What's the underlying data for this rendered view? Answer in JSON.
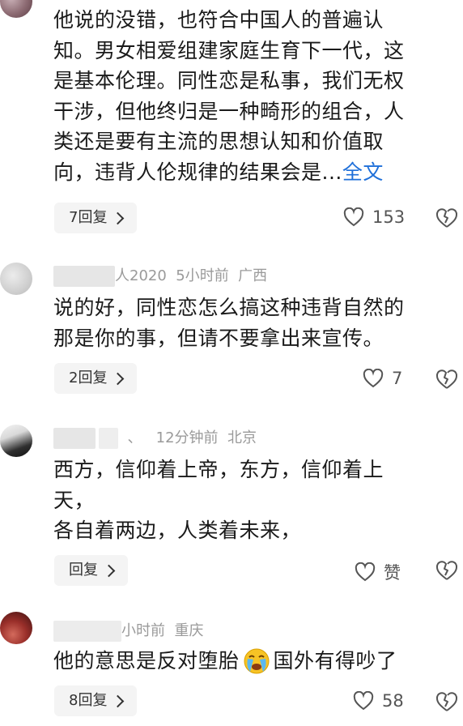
{
  "comments": [
    {
      "text_lines": [
        "他说的没错，也符合中国人的普遍认",
        "知。男女相爱组建家庭生育下一代，这",
        "是基本伦理。同性恋是私事，我们无权",
        "干涉，但他终归是一种畸形的组合，人",
        "类还是要有主流的思想认知和价值取",
        "向，违背人伦规律的结果会是..."
      ],
      "full_label": "全文",
      "reply_label": "7回复",
      "like_count": "153"
    },
    {
      "user": "人2020",
      "time": "5小时前",
      "location": "广西",
      "text_lines": [
        "说的好，同性恋怎么搞这种违背自然的",
        "那是你的事，但请不要拿出来宣传。"
      ],
      "reply_label": "2回复",
      "like_count": "7"
    },
    {
      "user": "、",
      "time": "12分钟前",
      "location": "北京",
      "text_lines": [
        "西方，信仰着上帝，东方，信仰着上",
        "天，",
        "各自着两边，人类着未来，"
      ],
      "reply_label": "回复",
      "like_count": "赞"
    },
    {
      "user": "",
      "time": "小时前",
      "location": "重庆",
      "text_before_emoji": "他的意思是反对堕胎",
      "emoji": "crying-face-emoji",
      "text_after_emoji": "国外有得吵了",
      "reply_label": "8回复",
      "like_count": "58"
    }
  ]
}
